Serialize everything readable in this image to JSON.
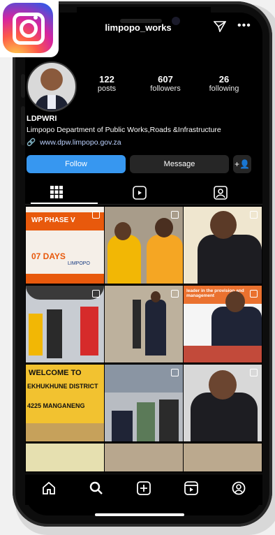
{
  "profile": {
    "username": "limpopo_works",
    "stats": [
      {
        "value": "122",
        "label": "posts"
      },
      {
        "value": "607",
        "label": "followers"
      },
      {
        "value": "26",
        "label": "following"
      }
    ],
    "name": "LDPWRI",
    "bio": "Limpopo Department of Public Works,Roads &Infrastructure",
    "link": "www.dpw.limpopo.gov.za"
  },
  "actions": {
    "follow": "Follow",
    "message": "Message"
  },
  "posts": [
    {
      "text": "WP PHASE V",
      "sub": "07 DAYS",
      "tag": "LIMPOPO"
    },
    {
      "text": "",
      "sub": "",
      "tag": ""
    },
    {
      "text": "",
      "sub": "",
      "tag": ""
    },
    {
      "text": "",
      "sub": "",
      "tag": ""
    },
    {
      "text": "",
      "sub": "",
      "tag": ""
    },
    {
      "text": "leader in the provision and management",
      "sub": "",
      "tag": ""
    },
    {
      "text": "WELCOME TO",
      "sub": "EKHUKHUNE DISTRICT",
      "tag": "4225 MANGANENG"
    },
    {
      "text": "",
      "sub": "",
      "tag": ""
    },
    {
      "text": "",
      "sub": "",
      "tag": ""
    }
  ],
  "colors": {
    "accent": "#3797f0",
    "background": "#000000",
    "button_secondary": "#262626"
  },
  "icons": {
    "logo": "instagram-logo",
    "top": [
      "send-icon",
      "more-icon"
    ],
    "tabs": [
      "grid-icon",
      "reels-icon",
      "tagged-icon"
    ],
    "nav": [
      "home-icon",
      "search-icon",
      "create-icon",
      "reels-icon",
      "profile-icon"
    ]
  }
}
